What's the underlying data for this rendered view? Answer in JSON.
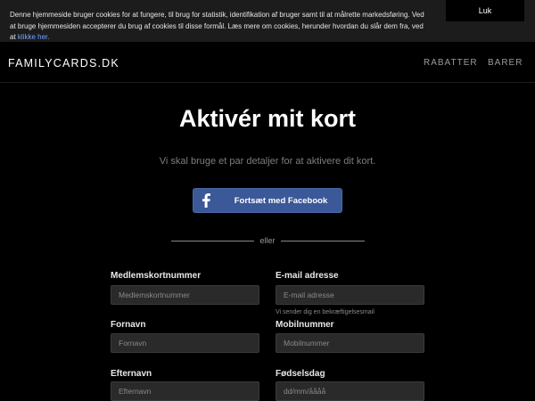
{
  "cookie_banner": {
    "text": "Denne hjemmeside bruger cookies for at fungere, til brug for statistik, identifikation af bruger samt til at målrette markedsføring. Ved at bruge hjemmesiden accepterer du brug af cookies til disse formål. Læs mere om cookies, herunder hvordan du slår dem fra, ved at ",
    "link_text": "klikke her.",
    "close_label": "Luk"
  },
  "navbar": {
    "brand": "FAMILYCARDS.DK",
    "links": [
      "RABATTER",
      "BARER"
    ]
  },
  "page": {
    "title": "Aktivér mit kort",
    "subtitle": "Vi skal bruge et par detaljer for at aktivere dit kort.",
    "facebook_button": "Fortsæt med Facebook",
    "divider": "eller"
  },
  "form": {
    "member_number": {
      "label": "Medlemskortnummer",
      "placeholder": "Medlemskortnummer"
    },
    "email": {
      "label": "E-mail adresse",
      "placeholder": "E-mail adresse",
      "help": "Vi sender dig en bekræftigelsesmail"
    },
    "first_name": {
      "label": "Fornavn",
      "placeholder": "Fornavn"
    },
    "mobile": {
      "label": "Mobilnummer",
      "placeholder": "Mobilnummer"
    },
    "last_name": {
      "label": "Efternavn",
      "placeholder": "Efternavn"
    },
    "birthday": {
      "label": "Fødselsdag",
      "placeholder": "dd/mm/åååå"
    }
  },
  "colors": {
    "facebook_blue": "#3b5998",
    "cookie_link": "#6fa6ff",
    "input_bg": "#2a2a2a"
  },
  "icons": {
    "facebook": "facebook-icon"
  }
}
